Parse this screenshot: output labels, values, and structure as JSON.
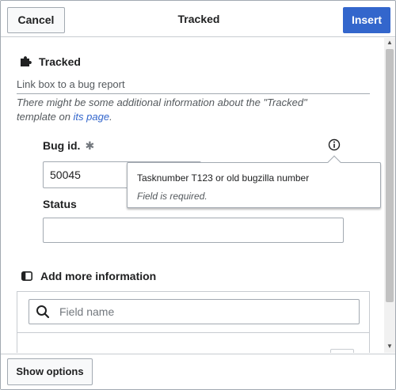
{
  "header": {
    "cancel_label": "Cancel",
    "title": "Tracked",
    "insert_label": "Insert"
  },
  "template": {
    "name": "Tracked",
    "description": "Link box to a bug report",
    "note_prefix": "There might be some additional information about the \"Tracked\" template on ",
    "note_link": "its page",
    "note_suffix": "."
  },
  "fields": {
    "bug_id": {
      "label": "Bug id.",
      "required_mark": "✱",
      "value": "50045"
    },
    "status": {
      "label": "Status",
      "value": ""
    }
  },
  "popup": {
    "description": "Tasknumber T123 or old bugzilla number",
    "error": "Field is required."
  },
  "more_info": {
    "title": "Add more information",
    "search_placeholder": "Field name"
  },
  "footer": {
    "show_options_label": "Show options"
  },
  "colors": {
    "accent": "#3366cc",
    "border": "#a2a9b1",
    "text": "#202122",
    "muted": "#54595d"
  }
}
